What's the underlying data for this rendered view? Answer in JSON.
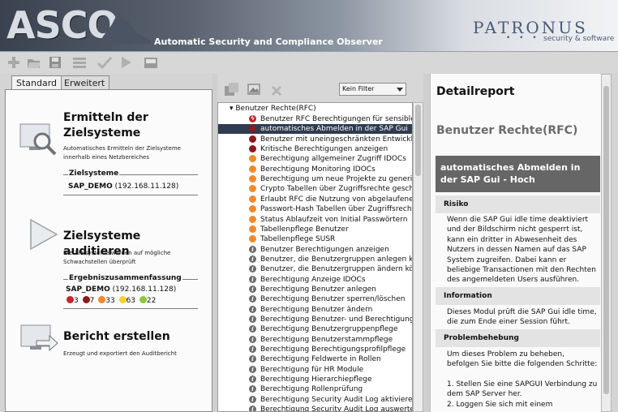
{
  "header": {
    "logo": "ASCO",
    "subtitle": "Automatic Security and Compliance Observer",
    "brand": "PATRONUS",
    "brand_dots": "• • •",
    "brand_sub": "security & software"
  },
  "toolbar": {
    "icons": [
      "add-icon",
      "open-folder-icon",
      "save-icon",
      "list-icon",
      "check-icon",
      "run-icon",
      "export-icon"
    ]
  },
  "left_panel": {
    "tabs": [
      "Standard",
      "Erweitert"
    ],
    "step1": {
      "title": "Ermitteln der Zielsysteme",
      "desc": "Automatisches Ermitteln der Zielsysteme innerhalb eines Netzbereiches",
      "group_label": "Zielsysteme",
      "system": "SAP_DEMO",
      "ip": "(192.168.11.128)"
    },
    "step2": {
      "title": "Zielsysteme auditieren",
      "desc": "Die Zielsysteme werden auf mögliche Schwachstellen überprüft",
      "group_label": "Ergebniszusammenfassung",
      "system": "SAP_DEMO",
      "ip": "(192.168.11.128)",
      "counts": [
        "3",
        "7",
        "33",
        "63",
        "22"
      ]
    },
    "step3": {
      "title": "Bericht erstellen",
      "desc": "Erzeugt und exportiert den Auditbericht"
    }
  },
  "middle_panel": {
    "filter": "Kein Filter",
    "root": "▾ Benutzer Rechte(RFC)",
    "items": [
      {
        "label": "Benutzer RFC Berechtigungen für sensible Z",
        "sev": "critical"
      },
      {
        "label": "automatisches Abmelden in der SAP Gui",
        "sev": "high",
        "selected": true
      },
      {
        "label": "Benutzer mit uneingeschränkten Entwicklung",
        "sev": "high"
      },
      {
        "label": "Kritische Berechtigungen anzeigen",
        "sev": "high"
      },
      {
        "label": "Berechtigung allgemeiner Zugriff IDOCs",
        "sev": "medium"
      },
      {
        "label": "Berechtigung Monitoring IDOCs",
        "sev": "medium"
      },
      {
        "label": "Berechtigung um neue Projekte zu generiere",
        "sev": "medium"
      },
      {
        "label": "Crypto Tabellen über Zugriffsrechte geschütz",
        "sev": "medium"
      },
      {
        "label": "Erlaubt RFC die Nutzung von abgelaufenem l",
        "sev": "medium"
      },
      {
        "label": "Passwort-Hash Tabellen über Zugriffsrechte",
        "sev": "medium"
      },
      {
        "label": "Status Ablaufzeit von Initial Passwörtern",
        "sev": "medium"
      },
      {
        "label": "Tabellenpflege Benutzer",
        "sev": "medium"
      },
      {
        "label": "Tabellenpflege SUSR",
        "sev": "medium"
      },
      {
        "label": "Benutzer Berechtigungen anzeigen",
        "sev": "info"
      },
      {
        "label": "Benutzer, die Benutzergruppen anlegen könn",
        "sev": "info"
      },
      {
        "label": "Benutzer, die Benutzergruppen ändern könne",
        "sev": "info"
      },
      {
        "label": "Berechtigung Anzeige IDOCs",
        "sev": "info"
      },
      {
        "label": "Berechtigung Benutzer anlegen",
        "sev": "info"
      },
      {
        "label": "Berechtigung Benutzer sperren/löschen",
        "sev": "info"
      },
      {
        "label": "Berechtigung Benutzer ändern",
        "sev": "info"
      },
      {
        "label": "Berechtigung Benutzer- und Berechtigungsve",
        "sev": "info"
      },
      {
        "label": "Berechtigung Benutzergruppenpflege",
        "sev": "info"
      },
      {
        "label": "Berechtigung Benutzerstammpflege",
        "sev": "info"
      },
      {
        "label": "Berechtigung Berechtigungsprofilpflege",
        "sev": "info"
      },
      {
        "label": "Berechtigung Feldwerte in Rollen",
        "sev": "info"
      },
      {
        "label": "Berechtigung für HR Module",
        "sev": "info"
      },
      {
        "label": "Berechtigung Hierarchiepflege",
        "sev": "info"
      },
      {
        "label": "Berechtigung Rollenprüfung",
        "sev": "info"
      },
      {
        "label": "Berechtigung Security Audit Log aktivieren un",
        "sev": "info"
      },
      {
        "label": "Berechtigung Security Audit Log auswerten",
        "sev": "info"
      }
    ]
  },
  "detail": {
    "title": "Detailreport",
    "module": "Benutzer Rechte(RFC)",
    "finding": "automatisches Abmelden in der SAP Gui - Hoch",
    "risk_label": "Risiko",
    "risk_text": "Wenn die SAP Gui idle time deaktiviert und der Bildschirm nicht gesperrt ist, kann ein dritter in Abwesenheit des Nutzers in dessen Namen auf das SAP System zugreifen. Dabei kann er beliebige Transactionen mit den Rechten des angemeldeten Users ausführen.",
    "info_label": "Information",
    "info_text": "Dieses Modul prüft die SAP Gui idle time, die zum Ende einer Session führt.",
    "fix_label": "Problembehebung",
    "fix_lines": [
      "Um dieses Problem zu beheben, befolgen Sie bitte die folgenden Schritte:",
      "",
      "1. Stellen Sie eine SAPGUI Verbindung zu dem SAP Server her.",
      "2. Loggen Sie sich mit einem"
    ]
  },
  "colors": {
    "critical": "#c0282d",
    "high": "#8b1a1a",
    "medium": "#ef8a2c",
    "low": "#f2d22e",
    "info": "#6b6b6b",
    "selected": "#2f3b50"
  }
}
